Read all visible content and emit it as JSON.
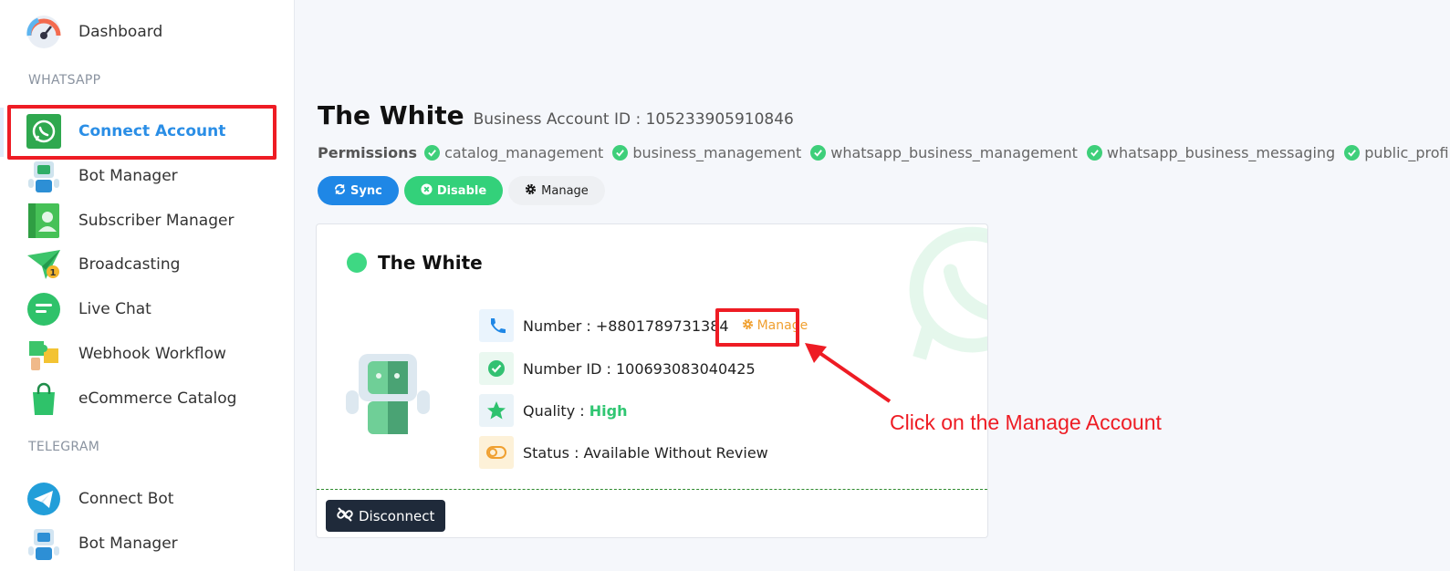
{
  "sidebar": {
    "items": [
      {
        "label": "Dashboard",
        "icon": "gauge-icon"
      },
      {
        "label": "Connect Account",
        "icon": "whatsapp-icon"
      },
      {
        "label": "Bot Manager",
        "icon": "robot-icon"
      },
      {
        "label": "Subscriber Manager",
        "icon": "contact-book-icon"
      },
      {
        "label": "Broadcasting",
        "icon": "paper-plane-icon"
      },
      {
        "label": "Live Chat",
        "icon": "chat-bubble-icon"
      },
      {
        "label": "Webhook Workflow",
        "icon": "puzzle-icon"
      },
      {
        "label": "eCommerce Catalog",
        "icon": "shopping-bag-icon"
      }
    ],
    "sections": {
      "whatsapp": "WHATSAPP",
      "telegram": "TELEGRAM"
    },
    "telegram_items": [
      {
        "label": "Connect Bot",
        "icon": "telegram-icon"
      },
      {
        "label": "Bot Manager",
        "icon": "robot-icon"
      }
    ],
    "broadcast_badge": "1"
  },
  "account": {
    "name": "The White",
    "business_id": "Business Account ID : 105233905910846",
    "permissions_label": "Permissions",
    "permissions": [
      "catalog_management",
      "business_management",
      "whatsapp_business_management",
      "whatsapp_business_messaging",
      "public_profile"
    ]
  },
  "actions": {
    "sync": "Sync",
    "disable": "Disable",
    "manage": "Manage"
  },
  "card": {
    "name": "The White",
    "number": "Number : +8801789731384",
    "manage_link": "Manage",
    "number_id": "Number ID : 100693083040425",
    "quality_label": "Quality : ",
    "quality_value": "High",
    "status": "Status : Available Without Review",
    "disconnect": "Disconnect"
  },
  "annotation": {
    "text": "Click on the Manage Account"
  },
  "colors": {
    "accent": "#1f87e6",
    "green": "#33d17a",
    "annotation": "#ee1c24",
    "manage": "#f0a030"
  }
}
